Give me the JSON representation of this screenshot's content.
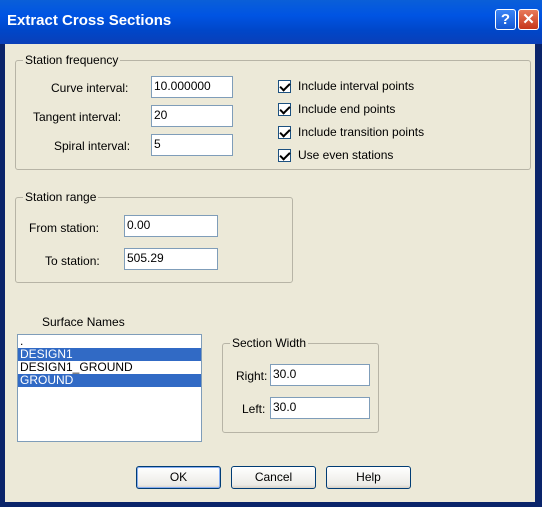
{
  "window": {
    "title": "Extract Cross Sections",
    "help_glyph": "?",
    "close_glyph": "✕"
  },
  "station_frequency": {
    "legend": "Station frequency",
    "curve_label": "Curve interval:",
    "curve_value": "10.000000",
    "tangent_label": "Tangent interval:",
    "tangent_value": "20",
    "spiral_label": "Spiral interval:",
    "spiral_value": "5",
    "checkboxes": [
      {
        "label": "Include interval points",
        "checked": true
      },
      {
        "label": "Include end points",
        "checked": true
      },
      {
        "label": "Include transition points",
        "checked": true
      },
      {
        "label": "Use even stations",
        "checked": true
      }
    ]
  },
  "station_range": {
    "legend": "Station range",
    "from_label": "From station:",
    "from_value": "0.00",
    "to_label": "To station:",
    "to_value": "505.29"
  },
  "surfaces": {
    "label": "Surface Names",
    "items": [
      {
        "name": ".",
        "selected": false
      },
      {
        "name": "DESIGN1",
        "selected": true
      },
      {
        "name": "DESIGN1_GROUND",
        "selected": false
      },
      {
        "name": "GROUND",
        "selected": true
      }
    ]
  },
  "section_width": {
    "legend": "Section Width",
    "right_label": "Right:",
    "right_value": "30.0",
    "left_label": "Left:",
    "left_value": "30.0"
  },
  "buttons": {
    "ok": "OK",
    "cancel": "Cancel",
    "help": "Help"
  },
  "colors": {
    "titlebar": "#0054e3",
    "face": "#ece9d8",
    "selection": "#316ac5"
  }
}
